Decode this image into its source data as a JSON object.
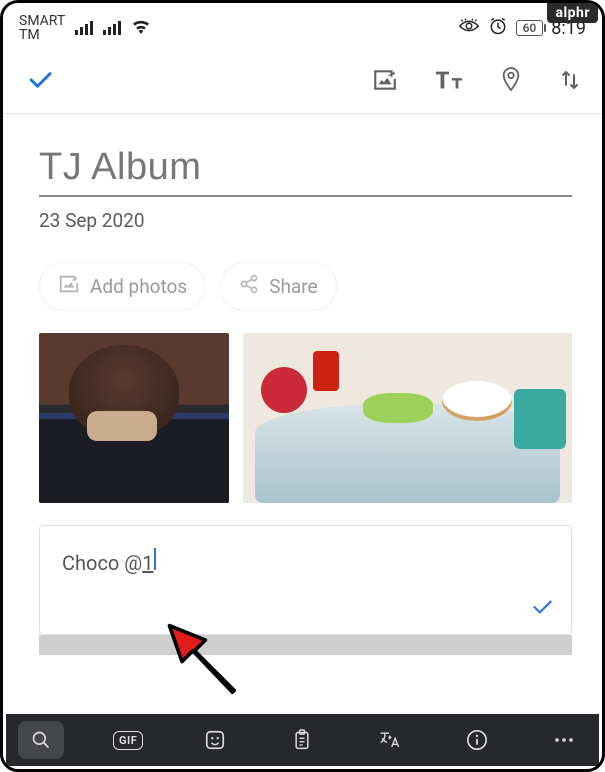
{
  "watermark": "alphr",
  "statusbar": {
    "carrier_line1": "SMART",
    "carrier_line2": "TM",
    "battery": "60",
    "time": "8:19"
  },
  "album": {
    "title": "TJ Album",
    "date": "23 Sep 2020"
  },
  "actions": {
    "add_photos": "Add photos",
    "share": "Share"
  },
  "caption": {
    "text": "Choco @ ",
    "trailing": "1"
  },
  "keyboard": {
    "gif": "GIF"
  }
}
